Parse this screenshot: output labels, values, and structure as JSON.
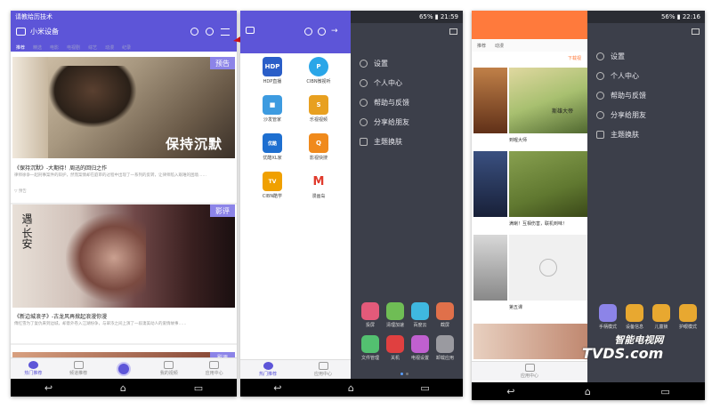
{
  "colors": {
    "primary": "#5d55d8",
    "drawer": "#3c3f4a",
    "orange": "#ff7a3c",
    "arrow": "#d0111b",
    "badge": "#8c84e8"
  },
  "left_phone": {
    "status_left": "请教给历技术",
    "app_title": "小米设备",
    "tabs": [
      "推荐",
      "精选",
      "电影",
      "电视剧",
      "综艺",
      "动漫",
      "纪录"
    ],
    "card1": {
      "badge": "预告",
      "poster_text": "保持沉默",
      "title": "《保持沉默》-大期待！周迅的回归之作",
      "desc": "律师徐争一起刑事案件的辩护，然而案情却在庭审的过程中出现了一系列的反转，让律师陷入艰难的困境……",
      "meta": "▽ 预告"
    },
    "card2": {
      "badge": "影评",
      "poster_text": "遇·长安",
      "title": "《新边城浪子》-古龙风再掀起浪漫你漫",
      "desc": "傅红雪为了复仇来到边城，却意外卷入江湖纷争，与翠浓之间上演了一段凄美动人的爱情故事……"
    },
    "card3_badge": "影评",
    "bottom_tabs": [
      "热门推荐",
      "频道推荐",
      "",
      "我的视频",
      "应用中心"
    ]
  },
  "middle_phone": {
    "status_right": "65% ▮ 21:59",
    "apps": [
      {
        "label": "HDP直播",
        "glyph": "HDP",
        "color": "#2a5ec8"
      },
      {
        "label": "CIBN微视听",
        "glyph": "P",
        "color": "#2aa6e8"
      },
      {
        "label": "沙发管家",
        "glyph": "■",
        "color": "#3d9be0"
      },
      {
        "label": "乐视视频",
        "glyph": "S",
        "color": "#e8a020"
      },
      {
        "label": "优酷XL家",
        "glyph": "优酷",
        "color": "#1e6fd0"
      },
      {
        "label": "影视快搜",
        "glyph": "Q",
        "color": "#f08a1c"
      },
      {
        "label": "CIBN酷学",
        "glyph": "TV",
        "color": "#f0a000"
      },
      {
        "label": "漫画岛",
        "glyph": "M",
        "color": "#e03a2c"
      }
    ],
    "menu": [
      "设置",
      "个人中心",
      "帮助与反馈",
      "分享给朋友",
      "主题换肤"
    ],
    "tiles": [
      {
        "label": "投屏",
        "color": "#e35a7a"
      },
      {
        "label": "清理加速",
        "color": "#6fbd55"
      },
      {
        "label": "百度云",
        "color": "#3fb8e0"
      },
      {
        "label": "截屏",
        "color": "#e0704a"
      },
      {
        "label": "文件管理",
        "color": "#53c070"
      },
      {
        "label": "关机",
        "color": "#e04040"
      },
      {
        "label": "电视设置",
        "color": "#c060d0"
      },
      {
        "label": "卸载应用",
        "color": "#9a9aa0"
      }
    ],
    "bottom_tabs": [
      "热门推荐",
      "应用中心"
    ]
  },
  "right_phone": {
    "status_right": "56% ▮ 22:16",
    "tabs": [
      "推荐",
      "动漫"
    ],
    "ad_label": "下载视",
    "items": [
      {
        "title": "到喔大师",
        "poster_text": "斯雄大帝"
      },
      {
        "title": "满喇！互相伤害，联机到味！"
      },
      {
        "title": "第五课"
      }
    ],
    "menu": [
      "设置",
      "个人中心",
      "帮助与反馈",
      "分享给朋友",
      "主题换肤"
    ],
    "tiles": [
      {
        "label": "手柄模式",
        "color": "#8c84e8"
      },
      {
        "label": "设备信息",
        "color": "#e8a830"
      },
      {
        "label": "儿童锁",
        "color": "#e8a830"
      },
      {
        "label": "护眼模式",
        "color": "#e8a830"
      }
    ],
    "bottom_tabs": [
      "应用中心"
    ]
  },
  "watermark": {
    "line1": "智能电视网",
    "line2": "TVDS.com"
  }
}
